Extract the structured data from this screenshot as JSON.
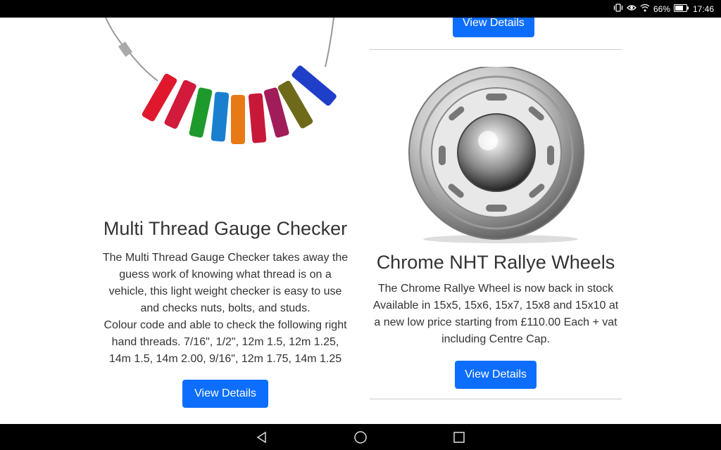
{
  "status": {
    "battery_pct": "66%",
    "time": "17:46"
  },
  "products": [
    {
      "title": "Multi Thread Gauge Checker",
      "description_lines": [
        "The Multi Thread Gauge Checker takes away the guess work of knowing what thread is on a vehicle, this light weight checker is easy to use and checks nuts, bolts, and studs.",
        "Colour code and able to check the following right hand threads. 7/16\", 1/2\", 12m 1.5, 12m 1.25, 14m 1.5, 14m 2.00, 9/16\", 12m 1.75, 14m 1.25"
      ],
      "button": "View Details",
      "image_icon": "thread-gauge-image"
    },
    {
      "title": "Chrome NHT Rallye Wheels",
      "description": "The Chrome Rallye Wheel is now back in stock Available in 15x5, 15x6, 15x7, 15x8 and 15x10 at a new low price starting from £110.00 Each + vat including Centre Cap.",
      "button": "View Details",
      "image_icon": "chrome-wheel-image"
    }
  ],
  "previous_button": "View Details",
  "colors": {
    "accent": "#0d6efd",
    "status_bar": "#000000"
  }
}
